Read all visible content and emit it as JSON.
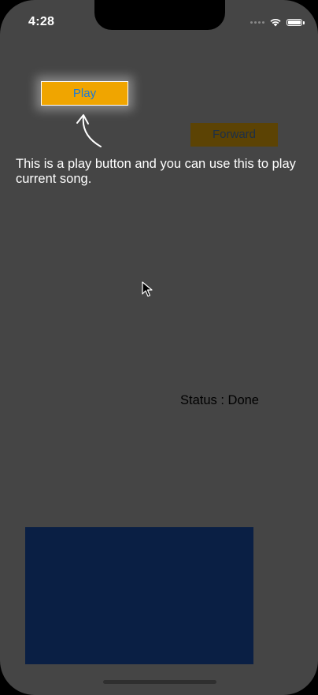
{
  "status_bar": {
    "time": "4:28"
  },
  "buttons": {
    "play_label": "Play",
    "forward_label": "Forward"
  },
  "tooltip": {
    "text": "This is a play button and you can use this to play current song."
  },
  "status": {
    "text": "Status : Done"
  },
  "colors": {
    "background": "#454545",
    "play_button_bg": "#f0a500",
    "play_button_text": "#1a7ad9",
    "forward_button_bg": "#5c4304",
    "media_panel_bg": "#0a1f44"
  },
  "icons": {
    "wifi": "wifi-icon",
    "battery": "battery-icon",
    "arrow": "curved-arrow-icon",
    "cursor": "mouse-pointer-icon"
  }
}
